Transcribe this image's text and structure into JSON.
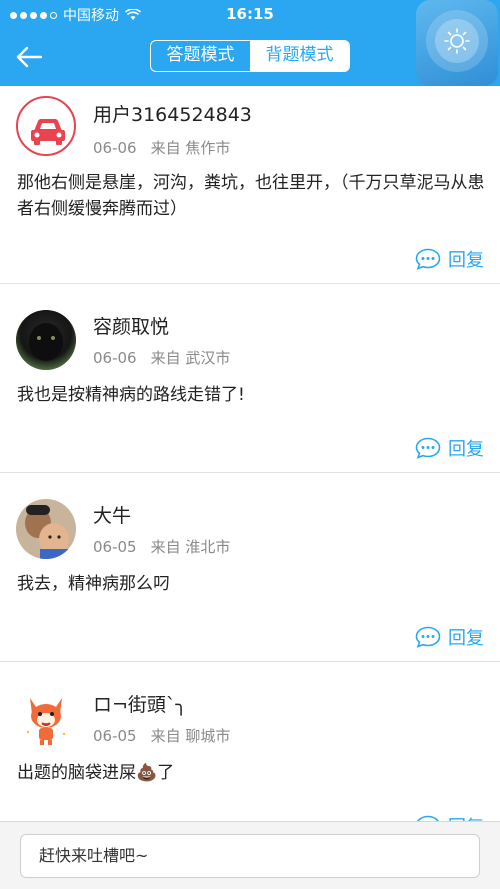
{
  "status_bar": {
    "carrier": "中国移动",
    "time": "16:15"
  },
  "nav": {
    "tabs": [
      {
        "label": "答题模式",
        "active": false
      },
      {
        "label": "背题模式",
        "active": true
      }
    ]
  },
  "comments": [
    {
      "username": "用户3164524843",
      "date": "06-06",
      "from": "来自 焦作市",
      "content": "那他右侧是悬崖，河沟，粪坑，也往里开，（千万只草泥马从患者右侧缓慢奔腾而过）",
      "reply_label": "回复",
      "avatar_icon": "car-icon"
    },
    {
      "username": "容颜取悦",
      "date": "06-06",
      "from": "来自 武汉市",
      "content": "我也是按精神病的路线走错了!",
      "reply_label": "回复",
      "avatar_icon": "panther-photo"
    },
    {
      "username": "大牛",
      "date": "06-05",
      "from": "来自 淮北市",
      "content": "我去，精神病那么叼",
      "reply_label": "回复",
      "avatar_icon": "child-photo"
    },
    {
      "username": "ロ¬街頭`╮",
      "date": "06-05",
      "from": "来自 聊城市",
      "content": "出题的脑袋进屎💩了",
      "reply_label": "回复",
      "avatar_icon": "fox-cartoon"
    }
  ],
  "input": {
    "placeholder": "赶快来吐槽吧~"
  },
  "colors": {
    "accent": "#2aa7f0",
    "car_avatar": "#e8434f"
  }
}
